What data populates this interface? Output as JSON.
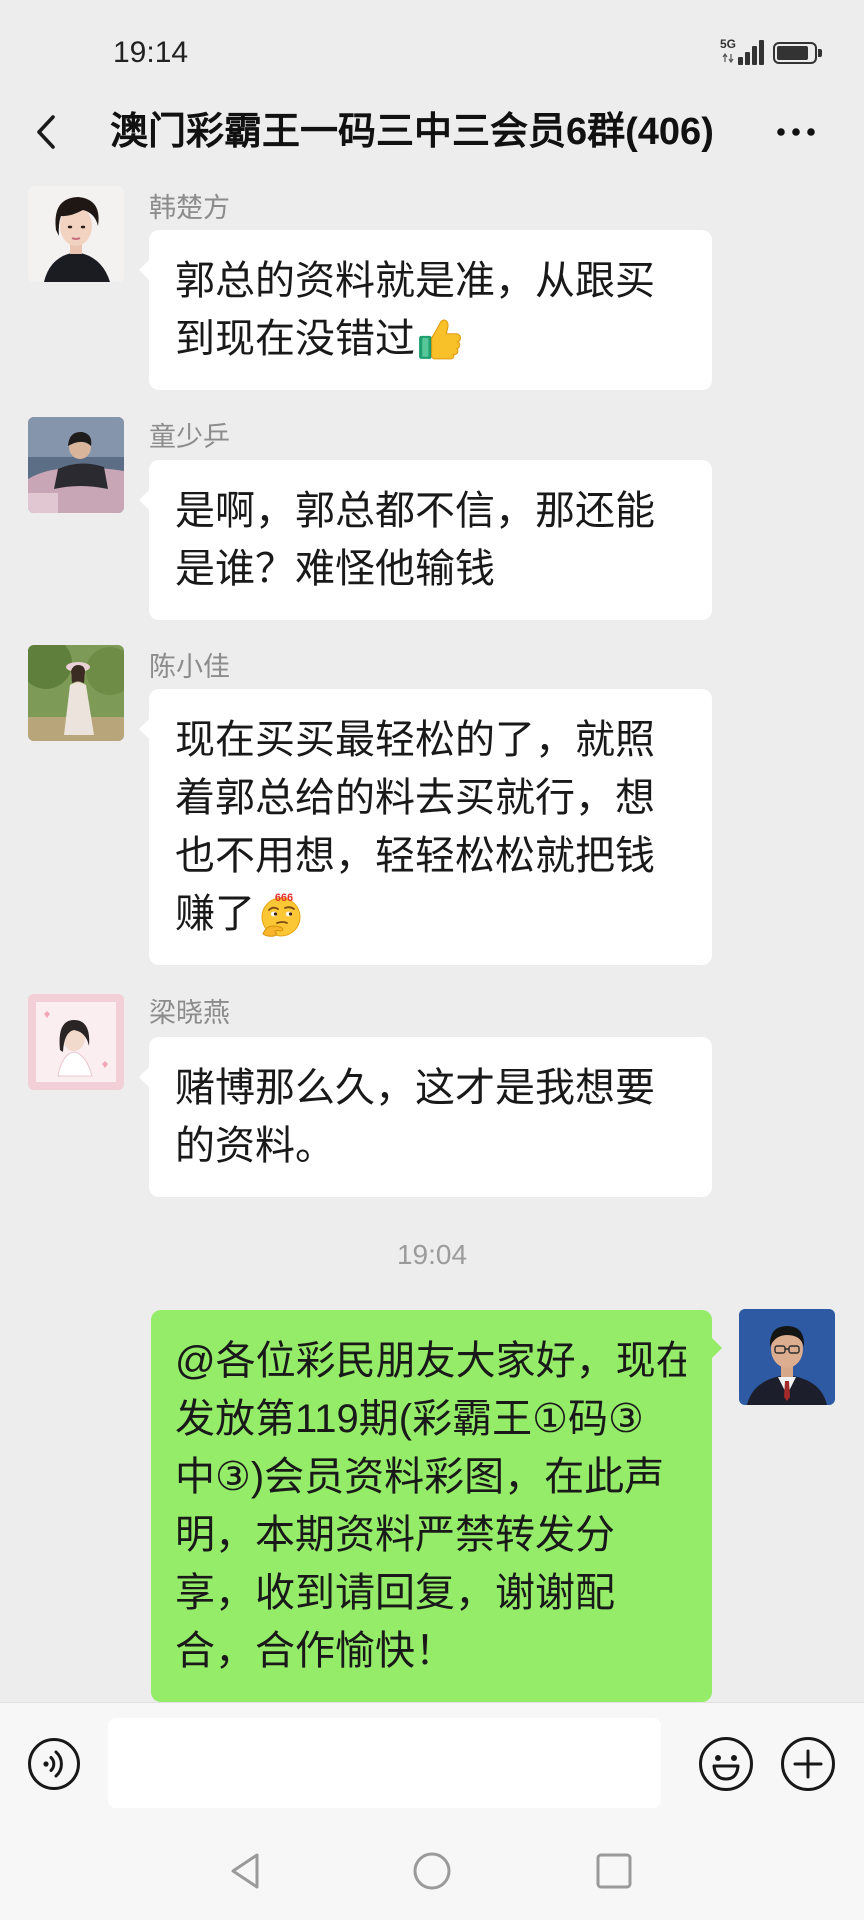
{
  "status_bar": {
    "time": "19:14",
    "network": "5G",
    "signal_icon": "signal-bars-icon",
    "battery_icon": "battery-icon",
    "battery_level": 0.85
  },
  "header": {
    "back_icon": "chevron-left-icon",
    "title": "澳门彩霸王一码三中三会员6群(406)",
    "more_icon": "more-dots-icon"
  },
  "messages": [
    {
      "sender": "韩楚方",
      "lines": [
        "郭总的资料就是准，从跟买",
        "到现在没错过"
      ],
      "emoji": "thumbs-up-emoji"
    },
    {
      "sender": "童少乒",
      "lines": [
        "是啊，郭总都不信，那还能",
        "是谁？难怪他输钱"
      ]
    },
    {
      "sender": "陈小佳",
      "lines": [
        "现在买买最轻松的了，就照",
        "着郭总给的料去买就行，想",
        "也不用想，轻轻松松就把钱",
        "赚了"
      ],
      "emoji": "thinking-666-emoji",
      "emoji_caption": "666"
    },
    {
      "sender": "梁晓燕",
      "lines": [
        "赌博那么久，这才是我想要",
        "的资料。"
      ]
    }
  ],
  "timestamp": "19:04",
  "own_message": {
    "lines": [
      "@各位彩民朋友大家好，现在",
      "发放第119期(彩霸王①码③",
      "中③)会员资料彩图，在此声",
      "明，本期资料严禁转发分",
      "享，收到请回复，谢谢配",
      "合，合作愉快！"
    ]
  },
  "input_bar": {
    "voice_icon": "voice-input-icon",
    "text_value": "",
    "emoji_icon": "emoji-smile-icon",
    "plus_icon": "plus-circle-icon"
  },
  "nav_bar": {
    "back_icon": "nav-back-triangle-icon",
    "home_icon": "nav-home-circle-icon",
    "recents_icon": "nav-recents-square-icon"
  },
  "colors": {
    "background": "#ededed",
    "bubble_incoming": "#ffffff",
    "bubble_outgoing": "#95ec69",
    "sender_name": "#8c8c8c",
    "input_bar": "#f7f7f7",
    "nav_icon": "#9a9a9a"
  }
}
